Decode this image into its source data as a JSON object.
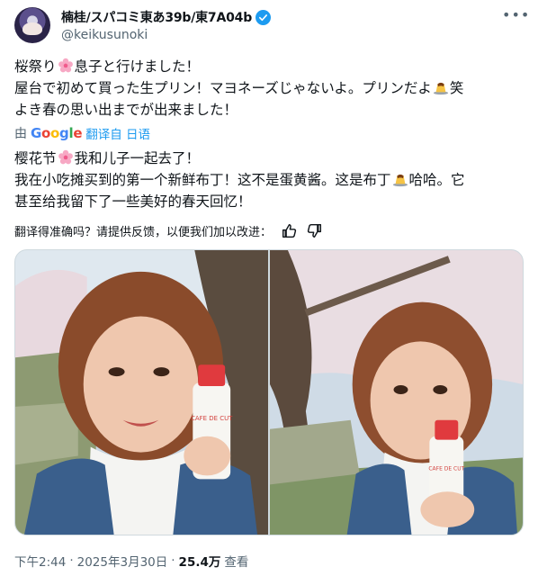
{
  "author": {
    "display_name": "楠桂/スパコミ東あ39b/東7A04b",
    "handle": "@keikusunoki",
    "avatar_icon": "avatar-icon",
    "verified_icon": "verified-badge-icon",
    "more_icon": "more-options-icon"
  },
  "original_text": {
    "line1_a": "桜祭り",
    "line1_b": "息子と行けました！",
    "line2_a": "屋台で初めて買った生プリン！マヨネーズじゃないよ。プリンだよ",
    "line2_b": "笑",
    "line3": "よき春の思い出までが出来ました！"
  },
  "translation_bar": {
    "prefix": "由",
    "google_g": "G",
    "google_o1": "o",
    "google_o2": "o",
    "google_g2": "g",
    "google_l": "l",
    "google_e": "e",
    "link": "翻译自 日语"
  },
  "translated_text": {
    "line1_a": "樱花节",
    "line1_b": "我和儿子一起去了！",
    "line2_a": "我在小吃摊买到的第一个新鲜布丁！这不是蛋黄酱。这是布丁",
    "line2_b": "哈哈。它",
    "line3": "甚至给我留下了一些美好的春天回忆！"
  },
  "feedback": {
    "question": "翻译得准确吗？请提供反馈，以便我们加以改进：",
    "thumbs_up_icon": "thumbs-up-icon",
    "thumbs_down_icon": "thumbs-down-icon"
  },
  "media": {
    "photos": [
      "photo-1",
      "photo-2"
    ],
    "bottle_text": "CAFE DE CUT"
  },
  "meta": {
    "time": "下午2:44",
    "sep1": "·",
    "date": "2025年3月30日",
    "sep2": "·",
    "views": "25.4万",
    "views_label": "查看"
  },
  "colors": {
    "accent": "#1d9bf0",
    "secondary_text": "#536471",
    "border": "#cfd9de"
  }
}
